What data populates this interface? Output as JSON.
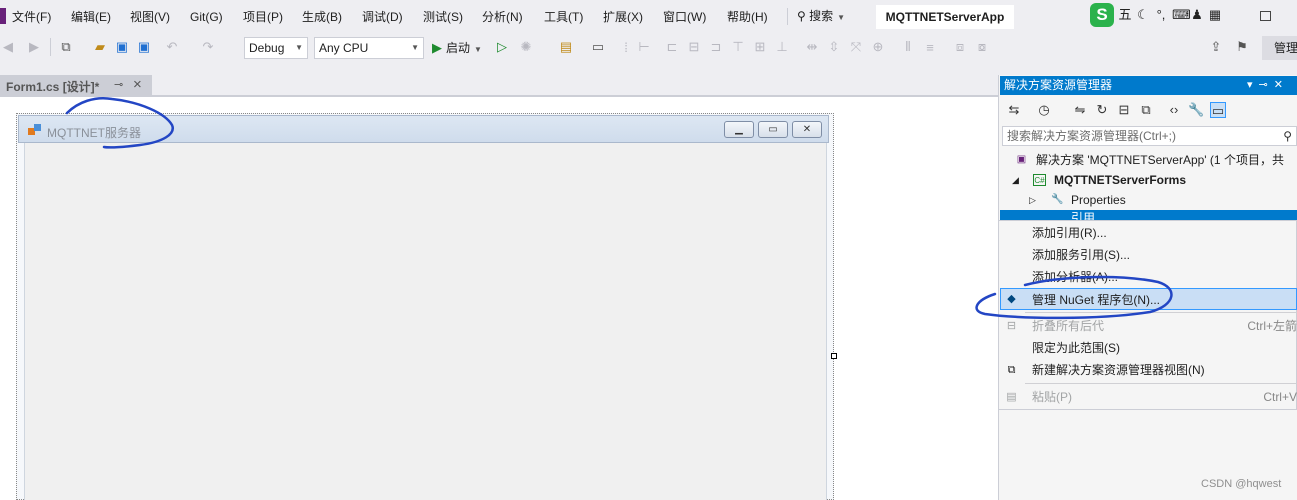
{
  "menu": {
    "items": [
      "文件(F)",
      "编辑(E)",
      "视图(V)",
      "Git(G)",
      "项目(P)",
      "生成(B)",
      "调试(D)",
      "测试(S)",
      "分析(N)",
      "工具(T)",
      "扩展(X)",
      "窗口(W)",
      "帮助(H)"
    ],
    "search_label": "搜索",
    "app_title": "MQTTNETServerApp"
  },
  "ime": {
    "logo": "S",
    "mode_char": "五"
  },
  "toolbar": {
    "config": "Debug",
    "platform": "Any CPU",
    "run_label": "启动",
    "manage_label": "管理"
  },
  "document_tab": {
    "label": "Form1.cs [设计]*"
  },
  "form_designer": {
    "form_title": "MQTTNET服务器"
  },
  "solution_explorer": {
    "title": "解决方案资源管理器",
    "search_placeholder": "搜索解决方案资源管理器(Ctrl+;)",
    "tree": {
      "solution": "解决方案 'MQTTNETServerApp' (1 个项目，共",
      "project": "MQTTNETServerForms",
      "properties": "Properties",
      "references": "引用"
    }
  },
  "context_menu": {
    "items": [
      {
        "label": "添加引用(R)...",
        "shortcut": "",
        "disabled": false
      },
      {
        "label": "添加服务引用(S)...",
        "shortcut": "",
        "disabled": false
      },
      {
        "label": "添加分析器(A)...",
        "shortcut": "",
        "disabled": false
      },
      {
        "label": "管理 NuGet 程序包(N)...",
        "shortcut": "",
        "disabled": false
      },
      {
        "label": "折叠所有后代",
        "shortcut": "Ctrl+左箭",
        "disabled": true
      },
      {
        "label": "限定为此范围(S)",
        "shortcut": "",
        "disabled": false
      },
      {
        "label": "新建解决方案资源管理器视图(N)",
        "shortcut": "",
        "disabled": false
      },
      {
        "label": "粘贴(P)",
        "shortcut": "Ctrl+V",
        "disabled": true
      }
    ]
  },
  "watermark": "CSDN @hqwest",
  "colors": {
    "accent": "#007acc",
    "highlight": "#c9def5",
    "annotation_ink": "#2346c4"
  }
}
